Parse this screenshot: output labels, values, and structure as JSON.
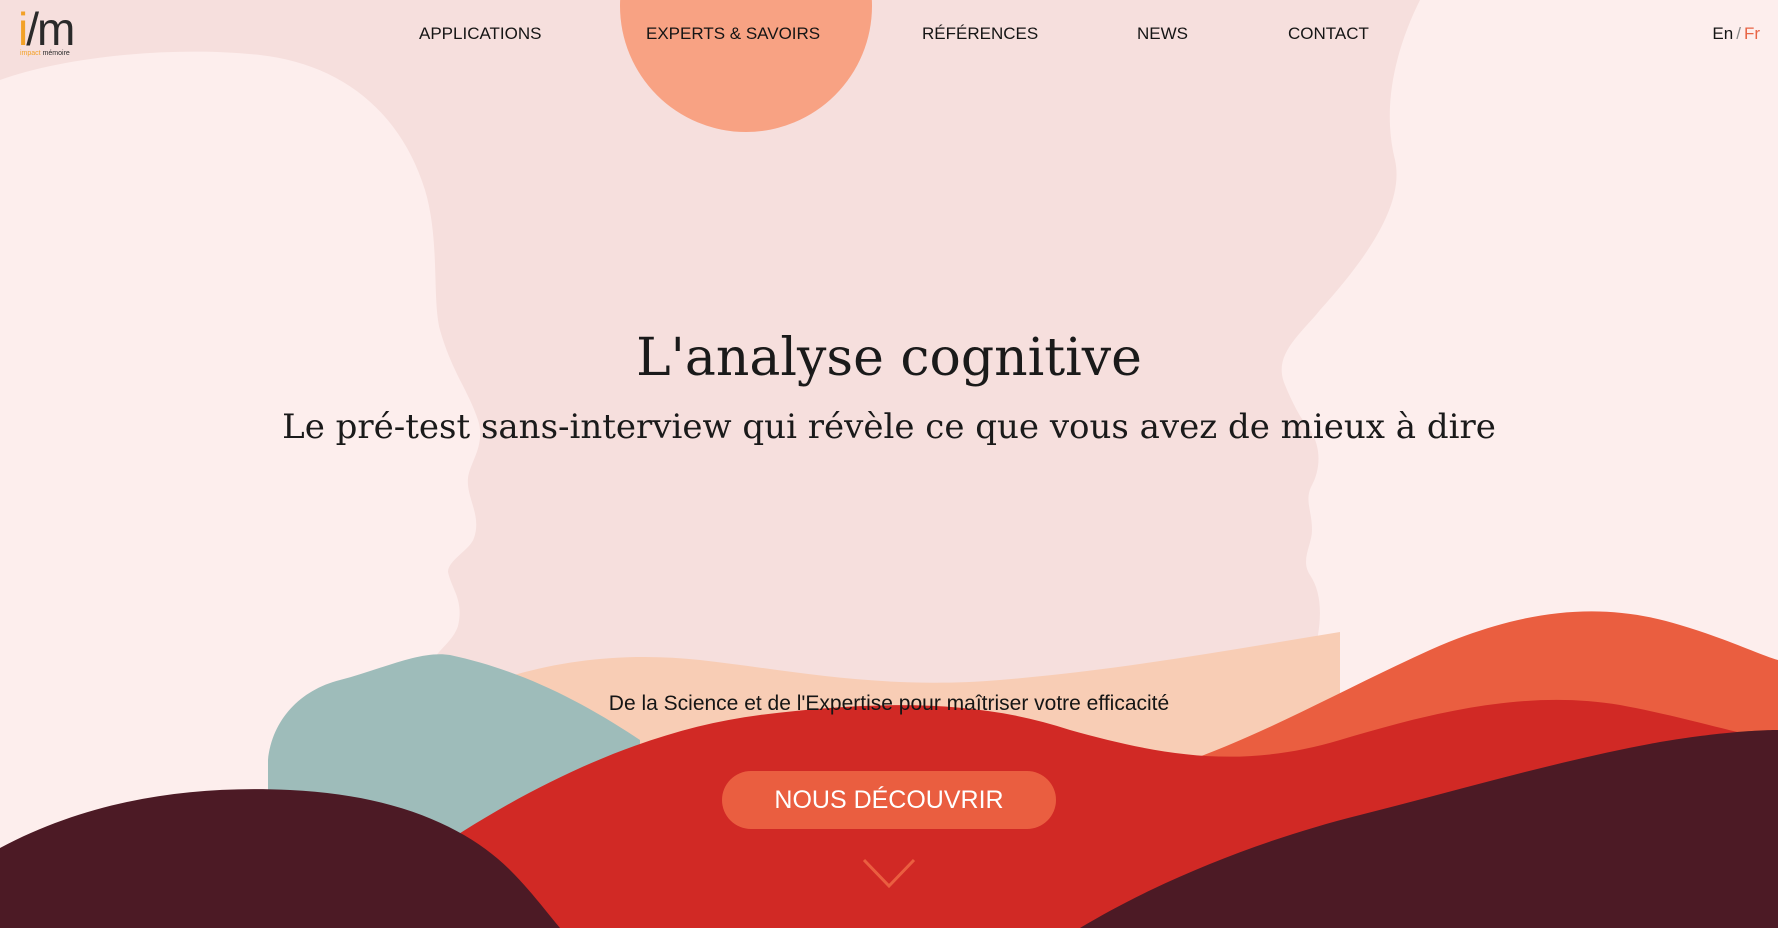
{
  "logo": {
    "mark_i": "i",
    "mark_slash": "/",
    "mark_m": "m",
    "subtitle_a": "impact",
    "subtitle_b": " mémoire"
  },
  "nav": {
    "items": [
      {
        "label": "APPLICATIONS"
      },
      {
        "label": "EXPERTS & SAVOIRS"
      },
      {
        "label": "RÉFÉRENCES"
      },
      {
        "label": "NEWS"
      },
      {
        "label": "CONTACT"
      }
    ]
  },
  "lang": {
    "en": "En",
    "separator": "/",
    "fr": "Fr",
    "active": "Fr"
  },
  "hero": {
    "title": "L'analyse cognitive",
    "subtitle": "Le pré-test  sans-interview  qui révèle ce que vous avez de mieux à dire",
    "tagline": "De la Science et de l'Expertise pour maîtriser votre efficacité",
    "cta_label": "NOUS DÉCOUVRIR"
  },
  "icons": {
    "scroll": "chevron-down-icon"
  },
  "colors": {
    "background": "#f6dfdd",
    "silhouette": "#fdeeed",
    "accent_peach": "#f8a283",
    "accent_orange": "#ea5e40",
    "accent_red": "#d12925",
    "accent_teal": "#9ebcba",
    "accent_sand": "#f8cdb5",
    "dark_maroon": "#4c1a25",
    "logo_orange": "#f2a127"
  }
}
